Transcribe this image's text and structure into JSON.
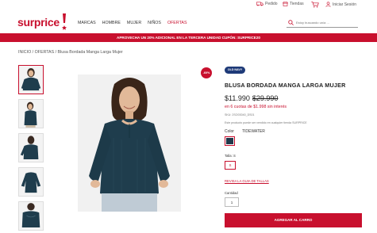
{
  "topbar": {
    "pedido": "Pedido",
    "tiendas": "Tiendas",
    "login": "Iniciar Sesión"
  },
  "header": {
    "logo": "surprice",
    "nav": [
      "MARCAS",
      "HOMBRE",
      "MUJER",
      "NIÑOS",
      "OFERTAS"
    ],
    "search_placeholder": "Estoy buscando un/a ..."
  },
  "promo": "APROVECHA UN 20% ADICIONAL EN LA TERCERA UNIDAD CUPÓN: SURPRICE20",
  "breadcrumb": "INICIO / OFERTAS / Blusa Bordada Manga Larga Mujer",
  "product": {
    "badge": "-60%",
    "brand": "OLD NAVY",
    "title": "BLUSA BORDADA MANGA LARGA MUJER",
    "price": "$11.990",
    "old_price": "$29.990",
    "installments": "en 6 cuotas de $1.998 sin interés",
    "sku": "SKU: 2SO03040_DS01",
    "note": "Este producto puede ser vendido en cualquier tienda SURPRICE",
    "color_label": "Color",
    "color_value": "TIDEWATER",
    "size_label": "Talla: S",
    "size": "S",
    "size_guide": "REVISA LA GUIA DE TALLAS",
    "qty_label": "Cantidad",
    "qty": "1",
    "add_to_cart": "AGREGAR AL CARRO"
  },
  "colors": {
    "brand": "#c8102e",
    "blouse": "#1f3d4d",
    "oldnavy": "#1e3a78"
  }
}
